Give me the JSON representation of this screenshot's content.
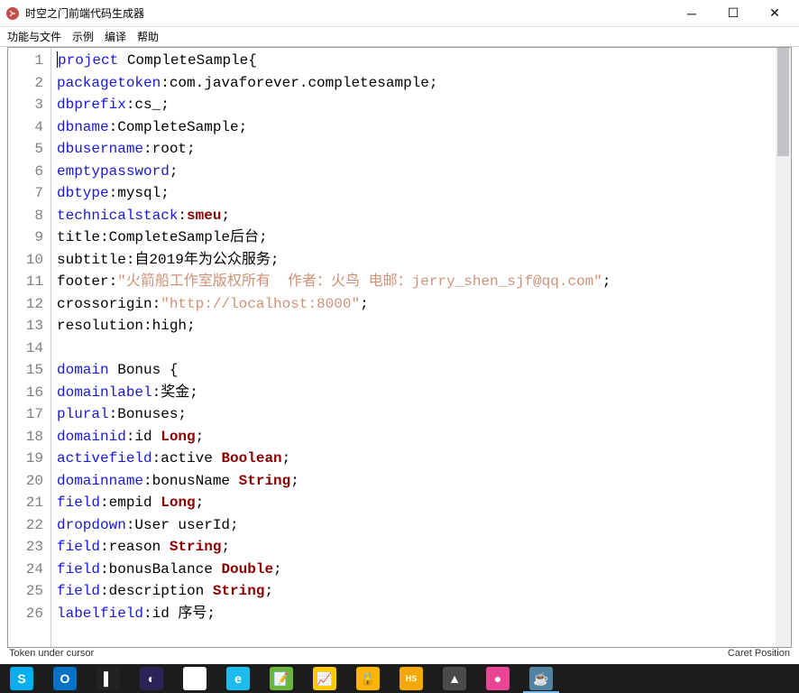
{
  "window": {
    "title": "时空之门前端代码生成器"
  },
  "menu": {
    "items": [
      "功能与文件",
      "示例",
      "编译",
      "帮助"
    ]
  },
  "code": {
    "lines": [
      [
        {
          "t": "project",
          "c": "kw-blue"
        },
        {
          "t": " CompleteSample{",
          "c": ""
        }
      ],
      [
        {
          "t": "packagetoken",
          "c": "kw-blue"
        },
        {
          "t": ":com.javaforever.completesample;",
          "c": ""
        }
      ],
      [
        {
          "t": "dbprefix",
          "c": "kw-blue"
        },
        {
          "t": ":cs_;",
          "c": ""
        }
      ],
      [
        {
          "t": "dbname",
          "c": "kw-blue"
        },
        {
          "t": ":CompleteSample;",
          "c": ""
        }
      ],
      [
        {
          "t": "dbusername",
          "c": "kw-blue"
        },
        {
          "t": ":root;",
          "c": ""
        }
      ],
      [
        {
          "t": "emptypassword",
          "c": "kw-blue"
        },
        {
          "t": ";",
          "c": ""
        }
      ],
      [
        {
          "t": "dbtype",
          "c": "kw-blue"
        },
        {
          "t": ":mysql;",
          "c": ""
        }
      ],
      [
        {
          "t": "technicalstack",
          "c": "kw-blue"
        },
        {
          "t": ":",
          "c": ""
        },
        {
          "t": "smeu",
          "c": "kw-dark"
        },
        {
          "t": ";",
          "c": ""
        }
      ],
      [
        {
          "t": "title:CompleteSample后台;",
          "c": ""
        }
      ],
      [
        {
          "t": "subtitle:自2019年为公众服务;",
          "c": ""
        }
      ],
      [
        {
          "t": "footer:",
          "c": ""
        },
        {
          "t": "\"火箭船工作室版权所有  作者：火鸟 电邮：jerry_shen_sjf@qq.com\"",
          "c": "str"
        },
        {
          "t": ";",
          "c": ""
        }
      ],
      [
        {
          "t": "crossorigin:",
          "c": ""
        },
        {
          "t": "\"http://localhost:8000\"",
          "c": "str"
        },
        {
          "t": ";",
          "c": ""
        }
      ],
      [
        {
          "t": "resolution:high;",
          "c": ""
        }
      ],
      [
        {
          "t": "",
          "c": ""
        }
      ],
      [
        {
          "t": "domain",
          "c": "kw-blue"
        },
        {
          "t": " Bonus {",
          "c": ""
        }
      ],
      [
        {
          "t": "domainlabel",
          "c": "kw-blue"
        },
        {
          "t": ":奖金;",
          "c": ""
        }
      ],
      [
        {
          "t": "plural",
          "c": "kw-blue"
        },
        {
          "t": ":Bonuses;",
          "c": ""
        }
      ],
      [
        {
          "t": "domainid",
          "c": "kw-blue"
        },
        {
          "t": ":id ",
          "c": ""
        },
        {
          "t": "Long",
          "c": "kw-dark"
        },
        {
          "t": ";",
          "c": ""
        }
      ],
      [
        {
          "t": "activefield",
          "c": "kw-blue"
        },
        {
          "t": ":active ",
          "c": ""
        },
        {
          "t": "Boolean",
          "c": "kw-dark"
        },
        {
          "t": ";",
          "c": ""
        }
      ],
      [
        {
          "t": "domainname",
          "c": "kw-blue"
        },
        {
          "t": ":bonusName ",
          "c": ""
        },
        {
          "t": "String",
          "c": "kw-dark"
        },
        {
          "t": ";",
          "c": ""
        }
      ],
      [
        {
          "t": "field",
          "c": "kw-blue"
        },
        {
          "t": ":empid ",
          "c": ""
        },
        {
          "t": "Long",
          "c": "kw-dark"
        },
        {
          "t": ";",
          "c": ""
        }
      ],
      [
        {
          "t": "dropdown",
          "c": "kw-blue"
        },
        {
          "t": ":User userId;",
          "c": ""
        }
      ],
      [
        {
          "t": "field",
          "c": "kw-blue"
        },
        {
          "t": ":reason ",
          "c": ""
        },
        {
          "t": "String",
          "c": "kw-dark"
        },
        {
          "t": ";",
          "c": ""
        }
      ],
      [
        {
          "t": "field",
          "c": "kw-blue"
        },
        {
          "t": ":bonusBalance ",
          "c": ""
        },
        {
          "t": "Double",
          "c": "kw-dark"
        },
        {
          "t": ";",
          "c": ""
        }
      ],
      [
        {
          "t": "field",
          "c": "kw-blue"
        },
        {
          "t": ":description ",
          "c": ""
        },
        {
          "t": "String",
          "c": "kw-dark"
        },
        {
          "t": ";",
          "c": ""
        }
      ],
      [
        {
          "t": "labelfield",
          "c": "kw-blue"
        },
        {
          "t": ":id 序号;",
          "c": ""
        }
      ]
    ]
  },
  "status": {
    "left": "Token under cursor",
    "right": "Caret Position"
  },
  "taskbar": {
    "icons": [
      "skype",
      "outlook",
      "terminal",
      "eclipse",
      "mail",
      "ie",
      "notepad",
      "chart",
      "lock",
      "hs",
      "photo",
      "paint",
      "java"
    ]
  }
}
